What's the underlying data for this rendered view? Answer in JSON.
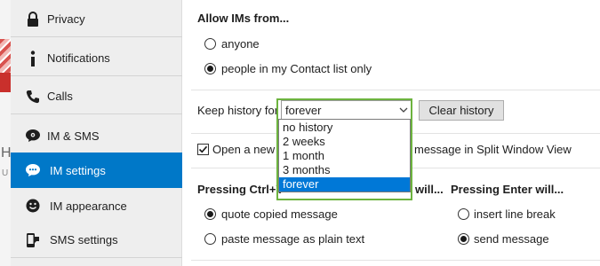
{
  "sidebar": {
    "items": [
      {
        "label": "Privacy",
        "icon": "lock-icon"
      },
      {
        "label": "Notifications",
        "icon": "info-icon"
      },
      {
        "label": "Calls",
        "icon": "phone-icon"
      },
      {
        "label": "IM & SMS",
        "icon": "chat-bubble-icon"
      },
      {
        "label": "IM settings",
        "icon": "chat-settings-icon",
        "active": true
      },
      {
        "label": "IM appearance",
        "icon": "smiley-icon"
      },
      {
        "label": "SMS settings",
        "icon": "sms-phone-icon"
      }
    ]
  },
  "main": {
    "allow_ims_header": "Allow IMs from...",
    "allow_options": [
      "anyone",
      "people in my Contact list only"
    ],
    "allow_selected": 1,
    "keep_history_label": "Keep history for",
    "keep_history_value": "forever",
    "clear_history_label": "Clear history",
    "history_options": [
      "no history",
      "2 weeks",
      "1 month",
      "3 months",
      "forever"
    ],
    "history_selected": 4,
    "split_window_text_left": "Open a new wi",
    "split_window_text_right": "message in Split Window View",
    "split_window_checked": true,
    "ctrlv_header": "Pressing Ctrl+V",
    "ctrlv_header_tail": "will...",
    "ctrlv_options": [
      "quote copied message",
      "paste message as plain text"
    ],
    "ctrlv_selected": 0,
    "enter_header": "Pressing Enter will...",
    "enter_options": [
      "insert line break",
      "send message"
    ],
    "enter_selected": 1
  },
  "colors": {
    "sidebar_active": "#0078c8",
    "dropdown_selected": "#0078d7",
    "focus_outline": "#6db33f"
  }
}
